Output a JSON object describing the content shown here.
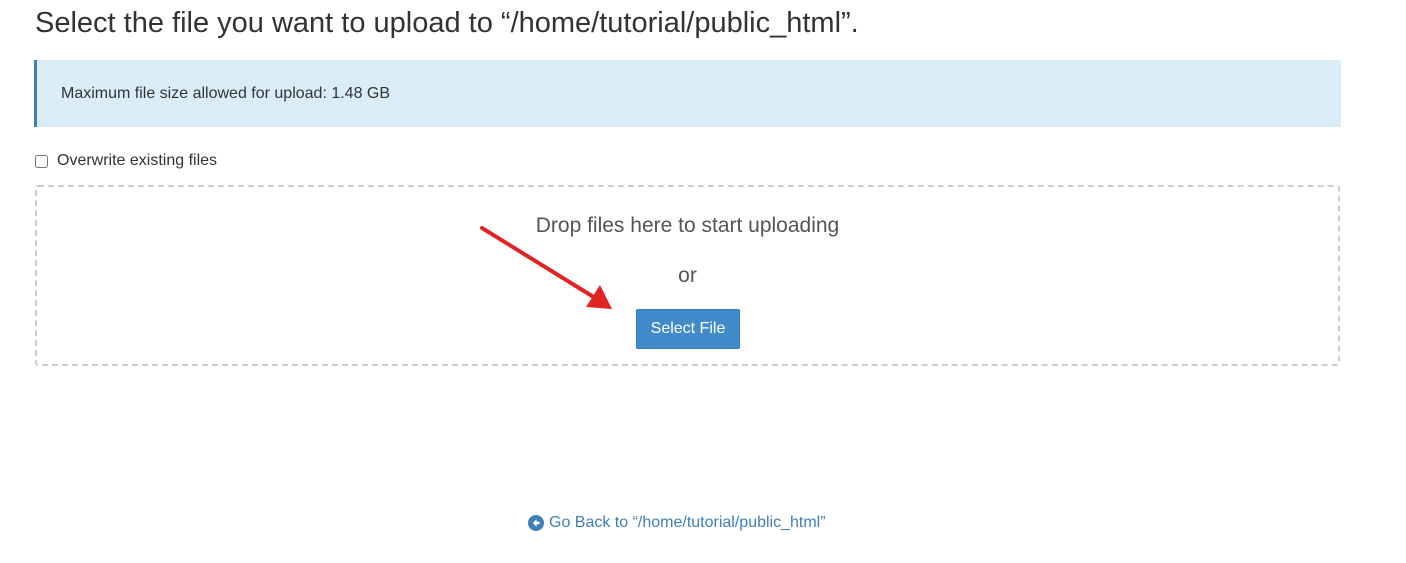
{
  "header": {
    "title": "Select the file you want to upload to “/home/tutorial/public_html”."
  },
  "alert": {
    "message": "Maximum file size allowed for upload: 1.48 GB"
  },
  "options": {
    "overwrite_label": "Overwrite existing files",
    "overwrite_checked": false
  },
  "dropzone": {
    "drop_text": "Drop files here to start uploading",
    "or_text": "or",
    "select_button_label": "Select File"
  },
  "footer": {
    "back_link_label": "Go Back to “/home/tutorial/public_html”",
    "back_icon": "circle-arrow-left-icon"
  },
  "colors": {
    "alert_background": "#d9ecf8",
    "alert_border": "#3d7fb8",
    "primary_button": "#428bca",
    "link": "#3d7fb8",
    "annotation_arrow": "#e02424"
  }
}
